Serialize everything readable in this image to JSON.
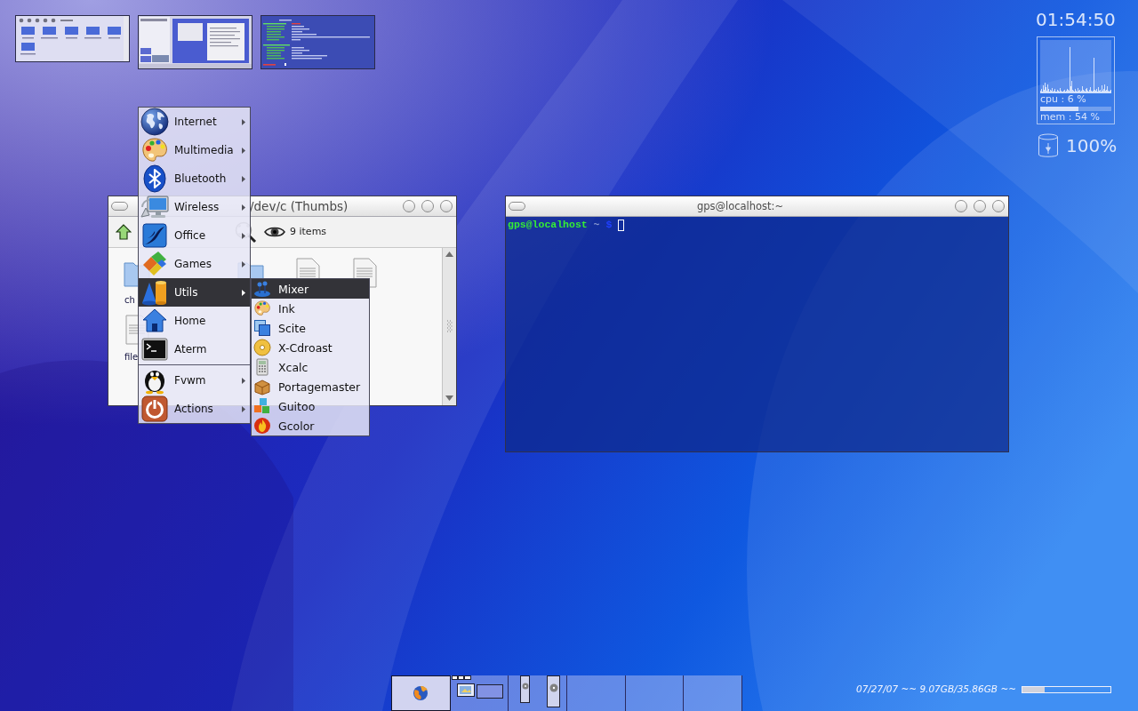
{
  "clock": {
    "time": "01:54:50"
  },
  "system_monitor": {
    "cpu_reading": "cpu : 6 %",
    "memory": {
      "level": 0.54
    },
    "memory_reading": "mem : 54 %"
  },
  "battery": {
    "reading": "100%"
  },
  "file_manager": {
    "title": "/dev/c (Thumbs)",
    "item_count": "9 items",
    "files": [
      {
        "kind": "folder",
        "name": "ch"
      },
      {
        "kind": "folder"
      },
      {
        "kind": "document"
      },
      {
        "kind": "document"
      },
      {
        "kind": "document",
        "name": "file"
      }
    ]
  },
  "terminal": {
    "title": "gps@localhost:~",
    "prompt": {
      "user_host": "gps@localhost",
      "path": "~",
      "symbol": "$"
    }
  },
  "menu": {
    "sections": [
      {
        "items": [
          {
            "label": "Internet",
            "submenu": true,
            "selected": false
          },
          {
            "label": "Multimedia",
            "submenu": true,
            "selected": false
          },
          {
            "label": "Bluetooth",
            "submenu": true,
            "selected": false
          },
          {
            "label": "Wireless",
            "submenu": true,
            "selected": false
          },
          {
            "label": "Office",
            "submenu": true,
            "selected": false
          },
          {
            "label": "Games",
            "submenu": true,
            "selected": false
          },
          {
            "label": "Utils",
            "submenu": true,
            "selected": true
          },
          {
            "label": "Home",
            "submenu": false,
            "selected": false
          },
          {
            "label": "Aterm",
            "submenu": false,
            "selected": false
          }
        ]
      },
      {
        "items": [
          {
            "label": "Fvwm",
            "submenu": true,
            "selected": false
          },
          {
            "label": "Actions",
            "submenu": true,
            "selected": false
          }
        ]
      }
    ]
  },
  "submenu": {
    "items": [
      {
        "label": "Mixer",
        "selected": true
      },
      {
        "label": "Ink",
        "selected": false
      },
      {
        "label": "Scite",
        "selected": false
      },
      {
        "label": "X-Cdroast",
        "selected": false
      },
      {
        "label": "Xcalc",
        "selected": false
      },
      {
        "label": "Portagemaster",
        "selected": false
      },
      {
        "label": "Guitoo",
        "selected": false
      },
      {
        "label": "Gcolor",
        "selected": false
      }
    ]
  },
  "taskbar": {
    "cells": [
      {
        "kind": "app",
        "selected": true
      },
      {
        "kind": "thumbnails",
        "selected": false
      },
      {
        "kind": "narrow_windows",
        "selected": false
      },
      {
        "kind": "empty",
        "selected": false
      },
      {
        "kind": "empty",
        "selected": false
      },
      {
        "kind": "empty",
        "selected": false
      }
    ]
  },
  "status_line": {
    "text": "07/27/07 ~~ 9.07GB/35.86GB ~~",
    "disk": {
      "level": 0.25
    }
  }
}
